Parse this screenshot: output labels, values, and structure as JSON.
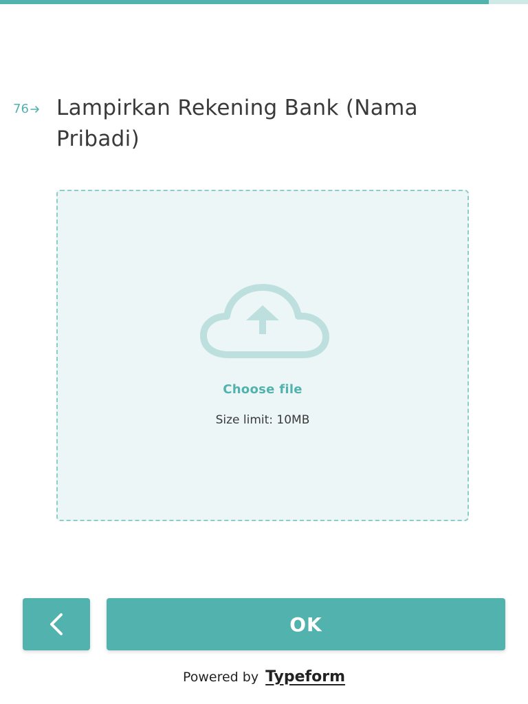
{
  "progress": {
    "percent": 92.6
  },
  "question": {
    "number": "76",
    "title": "Lampirkan Rekening Bank (Nama Pribadi)"
  },
  "upload": {
    "choose_label": "Choose file",
    "size_limit": "Size limit: 10MB"
  },
  "nav": {
    "ok_label": "OK"
  },
  "footer": {
    "powered_by": "Powered by",
    "brand": "Typeform"
  },
  "colors": {
    "accent": "#52b2ae",
    "dropzone_bg": "#edf6f6",
    "dropzone_border": "#8ccdc9",
    "cloud": "#bde0df"
  }
}
